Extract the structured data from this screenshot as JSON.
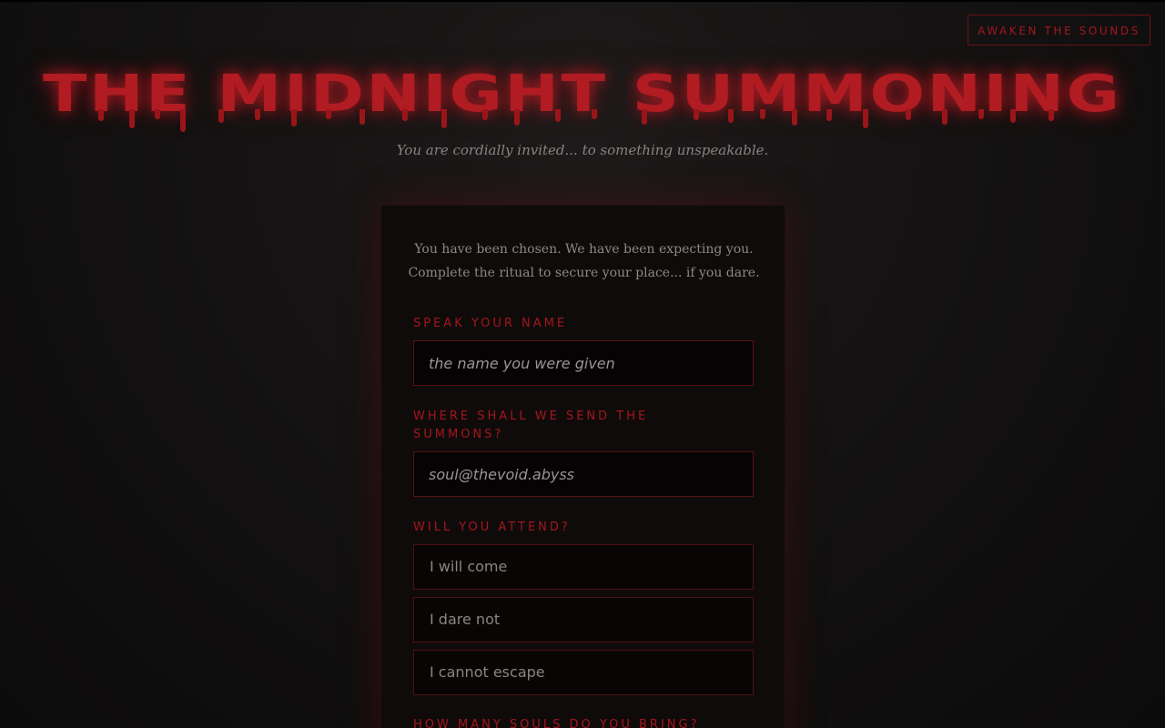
{
  "header": {
    "sound_button": "AWAKEN THE SOUNDS",
    "title": "THE MIDNIGHT SUMMONING",
    "subtitle": "You are cordially invited... to something unspeakable."
  },
  "form": {
    "intro_line1": "You have been chosen. We have been expecting you.",
    "intro_line2": "Complete the ritual to secure your place... if you dare.",
    "name_label": "SPEAK YOUR NAME",
    "name_placeholder": "the name you were given",
    "email_label": "WHERE SHALL WE SEND THE SUMMONS?",
    "email_placeholder": "soul@thevoid.abyss",
    "attend_label": "WILL YOU ATTEND?",
    "attend_options": [
      "I will come",
      "I dare not",
      "I cannot escape"
    ],
    "souls_label": "HOW MANY SOULS DO YOU BRING?"
  },
  "colors": {
    "accent": "#a3171c",
    "title": "#b01c22",
    "background": "#141212"
  }
}
